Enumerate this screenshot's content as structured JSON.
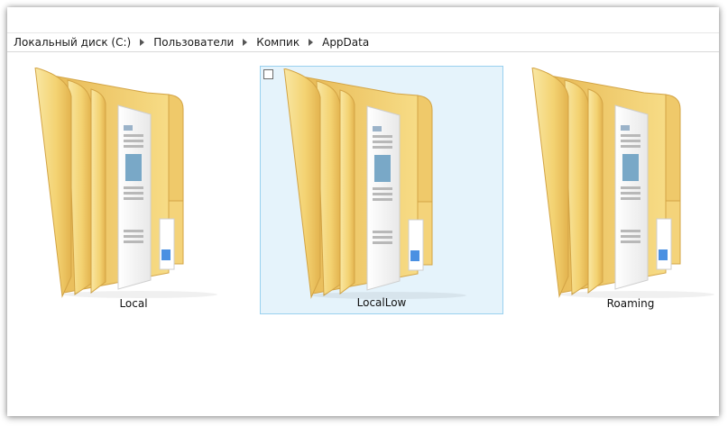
{
  "breadcrumb": {
    "items": [
      {
        "label": "Локальный диск (C:)"
      },
      {
        "label": "Пользователи"
      },
      {
        "label": "Компик"
      },
      {
        "label": "AppData"
      }
    ]
  },
  "folders": [
    {
      "name": "Local",
      "selected": false
    },
    {
      "name": "LocalLow",
      "selected": true
    },
    {
      "name": "Roaming",
      "selected": false
    }
  ],
  "colors": {
    "selection_bg": "#e5f3fb",
    "selection_border": "#99d1ef",
    "folder_yellow": "#f6d77a",
    "folder_dark": "#e3b34f"
  },
  "icons": {
    "folder": "folder-icon",
    "breadcrumb_separator": "chevron-right-icon",
    "checkbox": "checkbox-icon"
  }
}
